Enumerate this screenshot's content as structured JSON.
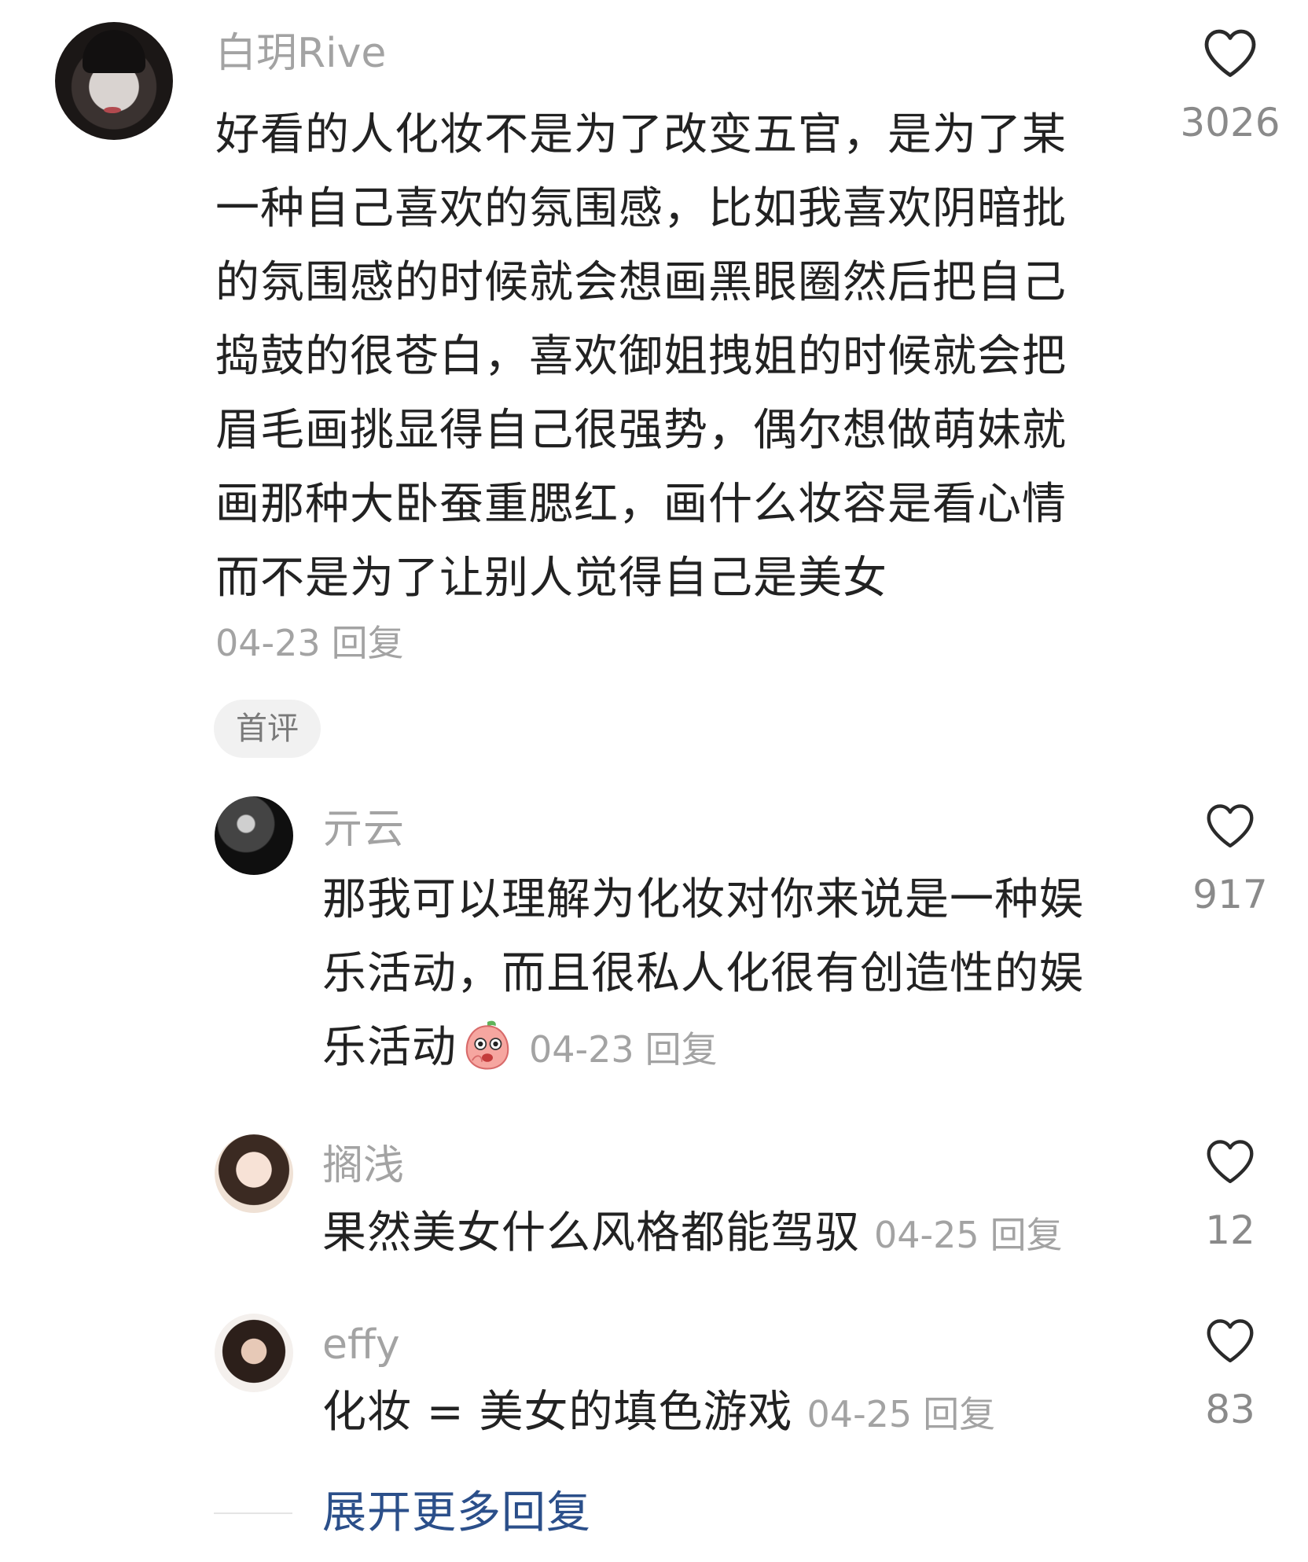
{
  "main_comment": {
    "username": "白玥Rive",
    "content_lines": [
      "好看的人化妆不是为了改变五官，是为了某",
      "一种自己喜欢的氛围感，比如我喜欢阴暗批",
      "的氛围感的时候就会想画黑眼圈然后把自己",
      "捣鼓的很苍白，喜欢御姐拽姐的时候就会把",
      "眉毛画挑显得自己很强势，偶尔想做萌妹就",
      "画那种大卧蚕重腮红，画什么妆容是看心情",
      "而不是为了让别人觉得自己是美女"
    ],
    "date": "04-23",
    "reply_label": "回复",
    "tag": "首评",
    "like_count": "3026",
    "like_icon": "heart-outline-icon"
  },
  "replies": [
    {
      "username": "亓云",
      "content_lines": [
        "那我可以理解为化妆对你来说是一种娱",
        "乐活动，而且很私人化很有创造性的娱",
        "乐活动"
      ],
      "emoji": "peach-emoji-icon",
      "date": "04-23",
      "reply_label": "回复",
      "like_count": "917"
    },
    {
      "username": "搁浅",
      "content": "果然美女什么风格都能驾驭",
      "date": "04-25",
      "reply_label": "回复",
      "like_count": "12"
    },
    {
      "username": "effy",
      "content": "化妆 = 美女的填色游戏",
      "date": "04-25",
      "reply_label": "回复",
      "like_count": "83"
    }
  ],
  "expand_more": "展开更多回复",
  "colors": {
    "username": "#a3a3a3",
    "text": "#222222",
    "meta": "#a3a3a3",
    "link": "#2b4f8a",
    "tag_bg": "#f1f1f1"
  }
}
